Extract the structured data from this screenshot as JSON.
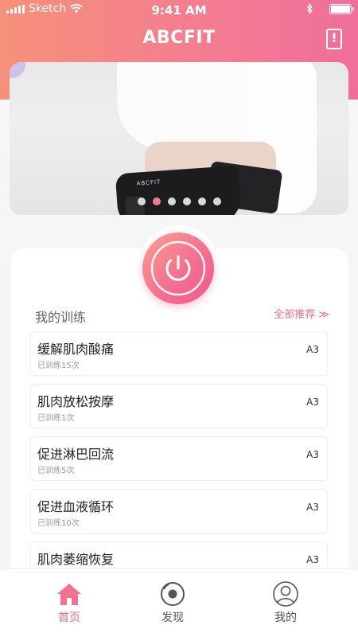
{
  "status_bar": {
    "carrier": "Sketch",
    "time": "9:41 AM"
  },
  "header": {
    "title": "ABCFIT",
    "alert_icon": "alert-icon"
  },
  "banner": {
    "brand_text": "ABCFIT",
    "dots_total": 6,
    "active_dot": 2
  },
  "section": {
    "title": "我的训练",
    "more_label": "全部推荐 ≫"
  },
  "trainings": [
    {
      "name": "缓解肌肉酸痛",
      "sub": "已训练15次",
      "tag": "A3"
    },
    {
      "name": "肌肉放松按摩",
      "sub": "已训练1次",
      "tag": "A3"
    },
    {
      "name": "促进淋巴回流",
      "sub": "已训练5次",
      "tag": "A3"
    },
    {
      "name": "促进血液循环",
      "sub": "已训练10次",
      "tag": "A3"
    },
    {
      "name": "肌肉萎缩恢复",
      "sub": "",
      "tag": "A3"
    }
  ],
  "tabs": [
    {
      "label": "首页",
      "icon": "home-icon",
      "active": true
    },
    {
      "label": "发现",
      "icon": "discover-icon",
      "active": false
    },
    {
      "label": "我的",
      "icon": "profile-icon",
      "active": false
    }
  ],
  "colors": {
    "accent": "#f06e8e",
    "header_start": "#f7907a",
    "header_end": "#f06e9a"
  }
}
